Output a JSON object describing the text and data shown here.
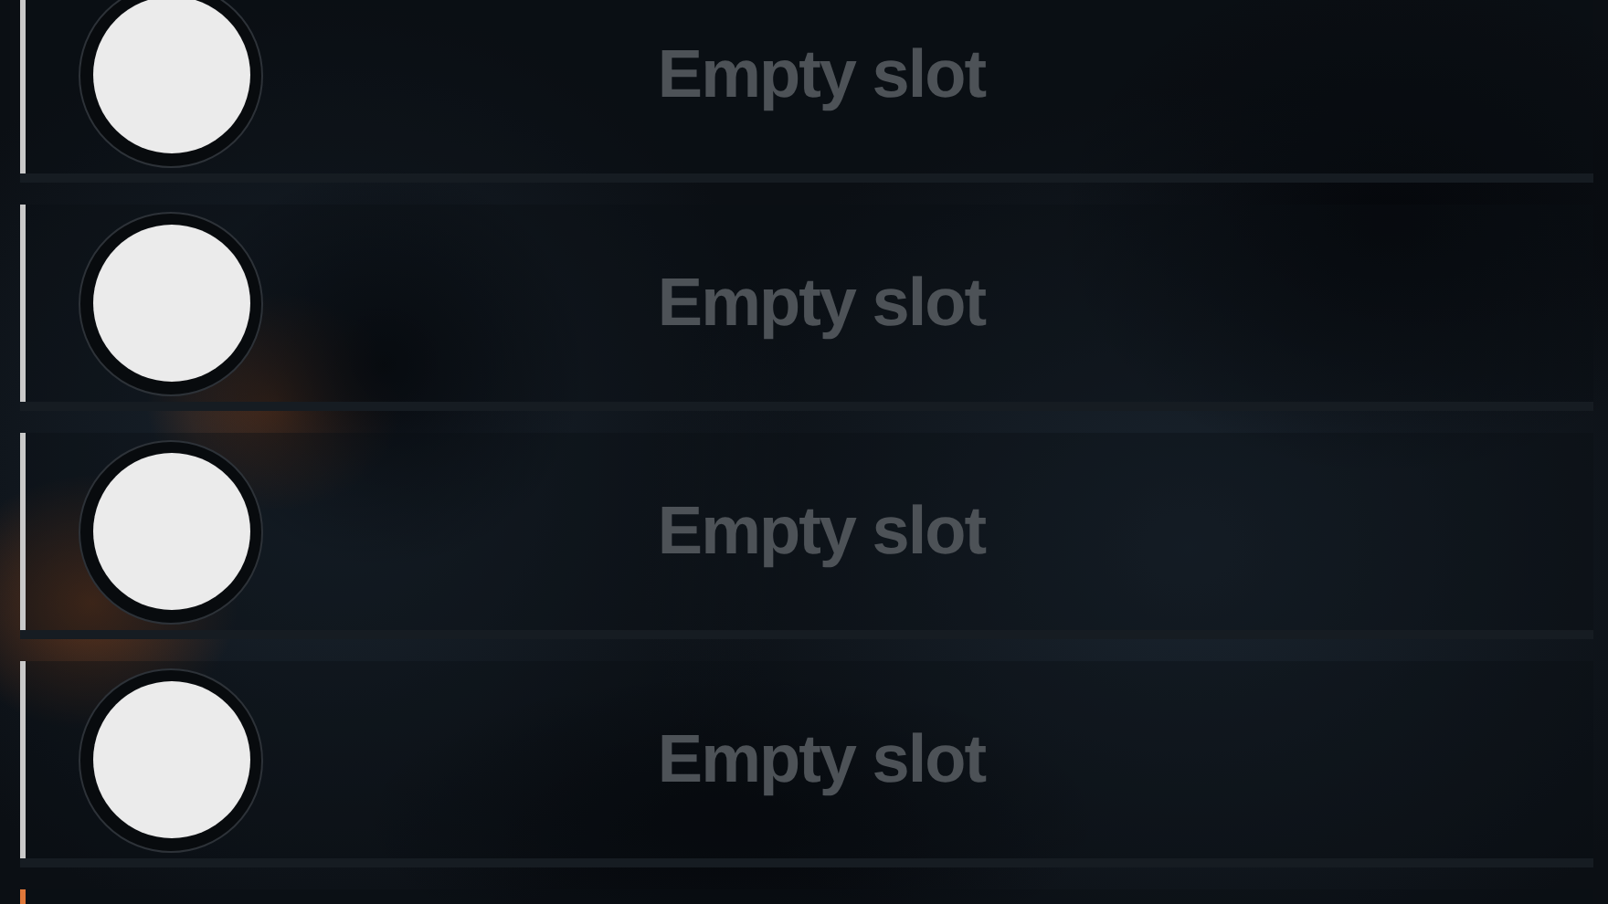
{
  "slots": [
    {
      "label": "Empty slot",
      "color": "#c9c9c9"
    },
    {
      "label": "Empty slot",
      "color": "#c9c9c9"
    },
    {
      "label": "Empty slot",
      "color": "#c9c9c9"
    },
    {
      "label": "Empty slot",
      "color": "#c9c9c9"
    },
    {
      "color": "#e0783a"
    }
  ]
}
